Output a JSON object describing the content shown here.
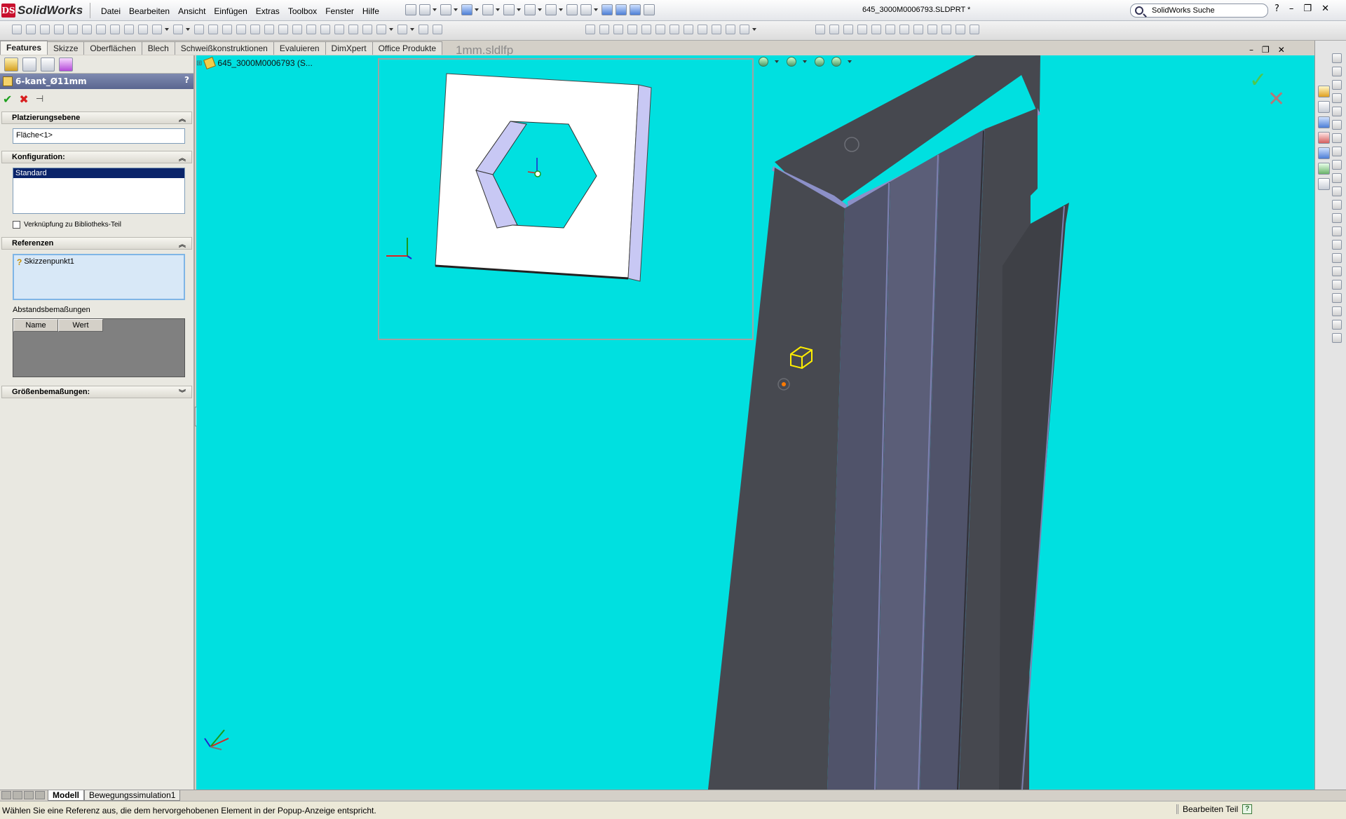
{
  "app": {
    "logo_text": "SolidWorks",
    "logo_badge": "DS",
    "document_title": "645_3000M0006793.SLDPRT *",
    "search_placeholder": "SolidWorks Suche"
  },
  "menu": [
    "Datei",
    "Bearbeiten",
    "Ansicht",
    "Einfügen",
    "Extras",
    "Toolbox",
    "Fenster",
    "Hilfe"
  ],
  "window_controls": {
    "help": "?",
    "minimize": "–",
    "restore": "❐",
    "close": "✕"
  },
  "tabs": [
    {
      "label": "Features",
      "active": true
    },
    {
      "label": "Skizze",
      "active": false
    },
    {
      "label": "Oberflächen",
      "active": false
    },
    {
      "label": "Blech",
      "active": false
    },
    {
      "label": "Schweißkonstruktionen",
      "active": false
    },
    {
      "label": "Evaluieren",
      "active": false
    },
    {
      "label": "DimXpert",
      "active": false
    },
    {
      "label": "Office Produkte",
      "active": false
    }
  ],
  "ghost_tab_label": "1mm.sldlfp",
  "property_manager": {
    "title": "6-kant_Ø11mm",
    "help": "?",
    "ok": "✔",
    "cancel": "✖",
    "pin": "⊣",
    "sections": {
      "placement": {
        "title": "Platzierungsebene",
        "value": "Fläche<1>"
      },
      "configuration": {
        "title": "Konfiguration:",
        "selected": "Standard",
        "link_label": "Verknüpfung zu Bibliotheks-Teil",
        "link_checked": false
      },
      "references": {
        "title": "Referenzen",
        "item": "Skizzenpunkt1",
        "dimension_label": "Abstandsbemaßungen",
        "columns": [
          "Name",
          "Wert"
        ]
      },
      "size": {
        "title": "Größenbemaßungen:"
      }
    }
  },
  "feature_tree_flyout": {
    "plus": "+",
    "label": "645_3000M0006793  (S..."
  },
  "bottom_tabs": [
    {
      "label": "Modell",
      "active": true
    },
    {
      "label": "Bewegungssimulation1",
      "active": false
    }
  ],
  "status": {
    "message": "Wählen Sie eine Referenz aus, die dem hervorgehobenen Element in der Popup-Anzeige entspricht.",
    "mode": "Bearbeiten Teil",
    "help": "?"
  },
  "colors": {
    "viewport_bg": "#00e0e0",
    "beam_dark": "#474950",
    "beam_face": "#5a5c72",
    "beam_highlight": "#8a8ec8",
    "plate_face": "#ffffff",
    "plate_edge": "#c8c8f4",
    "accent_yellow": "#ffee00",
    "point_orange": "#ff7a00"
  }
}
